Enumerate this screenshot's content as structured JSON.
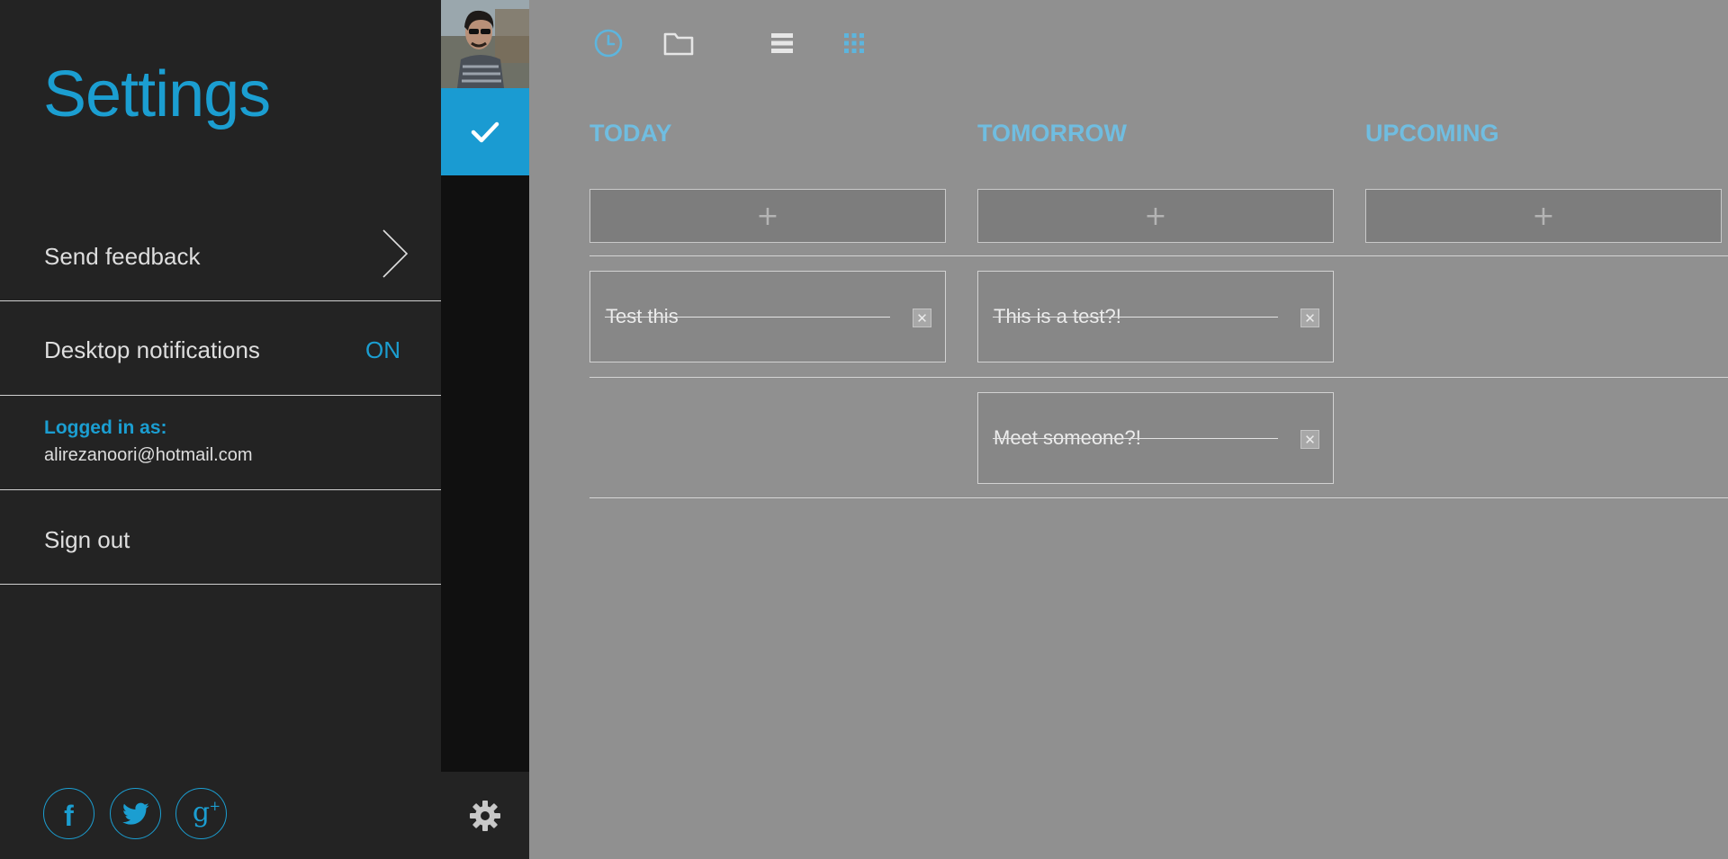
{
  "settings": {
    "title": "Settings",
    "feedback_label": "Send feedback",
    "notifications_label": "Desktop notifications",
    "notifications_state": "ON",
    "logged_in_label": "Logged in as:",
    "email": "alirezanoori@hotmail.com",
    "signout_label": "Sign out",
    "social": [
      "facebook-icon",
      "twitter-icon",
      "google-plus-icon"
    ]
  },
  "nav": {
    "items": [
      "avatar",
      "check-icon",
      "gear-icon"
    ]
  },
  "toolbar": {
    "icons": [
      "clock-icon",
      "folder-icon",
      "list-view-icon",
      "grid-view-icon"
    ]
  },
  "columns": [
    {
      "title": "TODAY",
      "add_label": "+",
      "tasks": [
        {
          "text": "Test this",
          "completed": true
        }
      ]
    },
    {
      "title": "TOMORROW",
      "add_label": "+",
      "tasks": [
        {
          "text": "This is a test?!",
          "completed": true
        },
        {
          "text": "Meet someone?!",
          "completed": true
        }
      ]
    },
    {
      "title": "UPCOMING",
      "add_label": "+",
      "tasks": []
    }
  ],
  "colors": {
    "accent": "#1b9ed1",
    "panel_bg": "#232323",
    "main_bg": "#909090"
  }
}
